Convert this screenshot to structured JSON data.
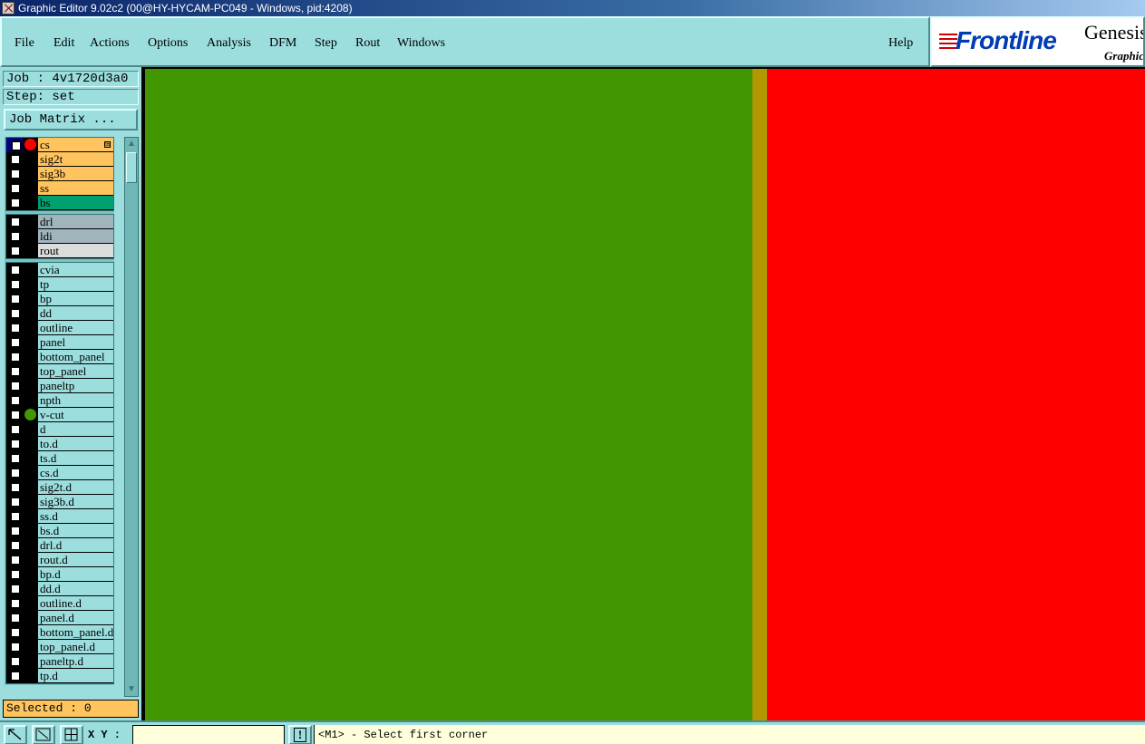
{
  "window": {
    "title": "Graphic Editor 9.02c2 (00@HY-HYCAM-PC049 - Windows, pid:4208)"
  },
  "menu": [
    {
      "label": "File",
      "name": "menu-file"
    },
    {
      "label": "Edit",
      "name": "menu-edit"
    },
    {
      "label": "Actions",
      "name": "menu-actions"
    },
    {
      "label": "Options",
      "name": "menu-options"
    },
    {
      "label": "Analysis",
      "name": "menu-analysis"
    },
    {
      "label": "DFM",
      "name": "menu-dfm"
    },
    {
      "label": "Step",
      "name": "menu-step"
    },
    {
      "label": "Rout",
      "name": "menu-rout"
    },
    {
      "label": "Windows",
      "name": "menu-windows"
    },
    {
      "label": "Help",
      "name": "menu-help"
    }
  ],
  "logo": {
    "brand": "Frontline",
    "product": "Genesis",
    "sub": "Graphic"
  },
  "job": {
    "job_label": "Job : 4v1720d3a0",
    "step_label": "Step: set",
    "matrix_button": "Job Matrix ..."
  },
  "layer_groups": [
    {
      "layers": [
        {
          "name": "cs",
          "color": "#ffc45e",
          "dot": "#ff0000",
          "selected": true,
          "expander": "⊞"
        },
        {
          "name": "sig2t",
          "color": "#ffc45e"
        },
        {
          "name": "sig3b",
          "color": "#ffc45e"
        },
        {
          "name": "ss",
          "color": "#ffc45e"
        },
        {
          "name": "bs",
          "color": "#00a070"
        }
      ]
    },
    {
      "layers": [
        {
          "name": "drl",
          "color": "#a0b4bc"
        },
        {
          "name": "ldi",
          "color": "#a0b4bc"
        },
        {
          "name": "rout",
          "color": "#dcdcdc"
        }
      ]
    },
    {
      "layers": [
        {
          "name": "cvia"
        },
        {
          "name": "tp"
        },
        {
          "name": "bp"
        },
        {
          "name": "dd"
        },
        {
          "name": "outline"
        },
        {
          "name": "panel"
        },
        {
          "name": "bottom_panel"
        },
        {
          "name": "top_panel"
        },
        {
          "name": "paneltp"
        },
        {
          "name": "npth"
        },
        {
          "name": "v-cut",
          "dot": "#429600"
        },
        {
          "name": "d"
        },
        {
          "name": "to.d"
        },
        {
          "name": "ts.d"
        },
        {
          "name": "cs.d"
        },
        {
          "name": "sig2t.d"
        },
        {
          "name": "sig3b.d"
        },
        {
          "name": "ss.d"
        },
        {
          "name": "bs.d"
        },
        {
          "name": "drl.d"
        },
        {
          "name": "rout.d"
        },
        {
          "name": "bp.d"
        },
        {
          "name": "dd.d"
        },
        {
          "name": "outline.d"
        },
        {
          "name": "panel.d"
        },
        {
          "name": "bottom_panel.d"
        },
        {
          "name": "top_panel.d"
        },
        {
          "name": "paneltp.d"
        },
        {
          "name": "tp.d"
        }
      ]
    }
  ],
  "selected_label": "Selected : 0",
  "bottom": {
    "xy_label": "X Y :",
    "xy_value": "",
    "status": "<M1> - Select first corner",
    "exclaim": "!"
  },
  "colors": {
    "canvas_green": "#429600",
    "canvas_olive": "#b49600",
    "canvas_red": "#ff0000",
    "panel_bg": "#9cdede",
    "default_layer": "#9cdede"
  }
}
